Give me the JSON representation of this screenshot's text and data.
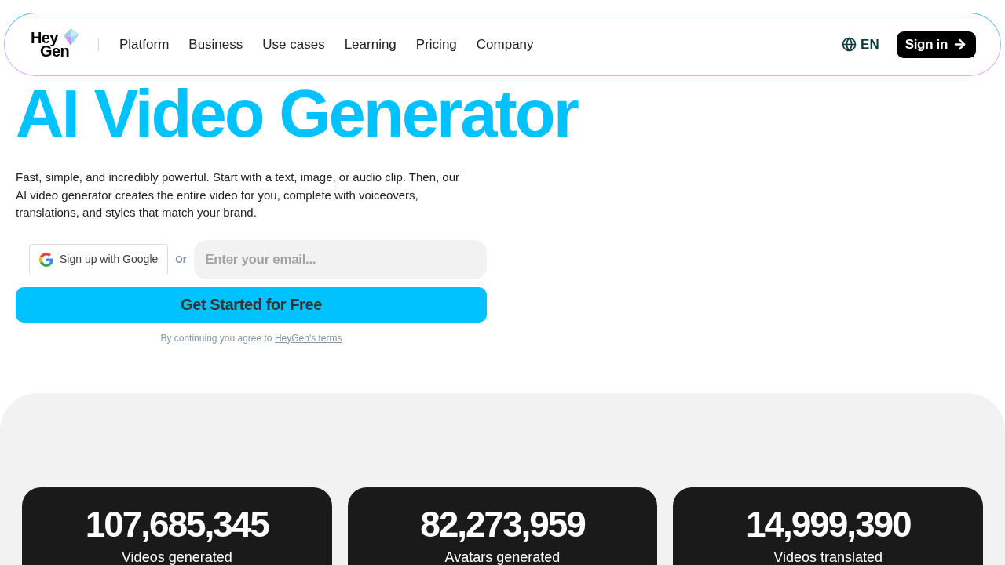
{
  "nav": {
    "logo": [
      "Hey",
      "Gen"
    ],
    "links": [
      "Platform",
      "Business",
      "Use cases",
      "Learning",
      "Pricing",
      "Company"
    ],
    "language": "EN",
    "sign_in": "Sign in"
  },
  "hero": {
    "title": "AI Video Generator",
    "description": "Fast, simple, and incredibly powerful. Start with a text, image, or audio clip. Then, our AI video generator creates the entire video for you, complete with voiceovers, translations, and styles that match your brand.",
    "google_button": "Sign up with Google",
    "or": "Or",
    "email": {
      "placeholder": "Enter your email..."
    },
    "cta": "Get Started for Free",
    "terms": {
      "text": "By continuing you agree to",
      "link": "HeyGen's terms"
    }
  },
  "stats": [
    {
      "value": "107,685,345",
      "label": "Videos generated"
    },
    {
      "value": "82,273,959",
      "label": "Avatars generated"
    },
    {
      "value": "14,999,390",
      "label": "Videos translated"
    }
  ]
}
